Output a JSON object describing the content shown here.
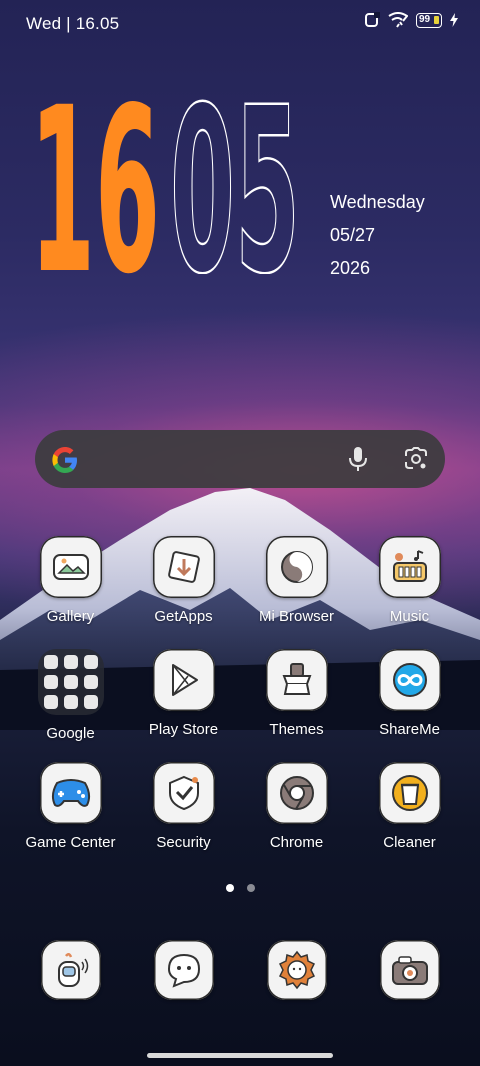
{
  "status_bar": {
    "time": "Wed | 16.05",
    "battery_level": "99",
    "charging": true
  },
  "clock": {
    "hour": "16",
    "minute": "05",
    "hour_color": "#ff8a1f",
    "minute_color": "#ffffff"
  },
  "date": {
    "weekday": "Wednesday",
    "month_day": "05/27",
    "year": "2026"
  },
  "search_bar": {
    "logo_icon": "google-g-icon",
    "voice_icon": "microphone-icon",
    "lens_icon": "camera-lens-icon"
  },
  "apps": [
    {
      "label": "Gallery",
      "icon": "gallery-icon"
    },
    {
      "label": "GetApps",
      "icon": "getapps-icon"
    },
    {
      "label": "Mi Browser",
      "icon": "mi-browser-icon"
    },
    {
      "label": "Music",
      "icon": "music-icon"
    },
    {
      "label": "Google",
      "icon": "folder-icon"
    },
    {
      "label": "Play Store",
      "icon": "play-store-icon"
    },
    {
      "label": "Themes",
      "icon": "themes-icon"
    },
    {
      "label": "ShareMe",
      "icon": "shareme-icon"
    },
    {
      "label": "Game Center",
      "icon": "game-center-icon"
    },
    {
      "label": "Security",
      "icon": "security-icon"
    },
    {
      "label": "Chrome",
      "icon": "chrome-icon"
    },
    {
      "label": "Cleaner",
      "icon": "cleaner-icon"
    }
  ],
  "page_indicator": {
    "pages": 2,
    "current": 1
  },
  "dock": [
    {
      "icon": "phone-icon"
    },
    {
      "icon": "messages-icon"
    },
    {
      "icon": "settings-icon"
    },
    {
      "icon": "camera-icon"
    }
  ]
}
